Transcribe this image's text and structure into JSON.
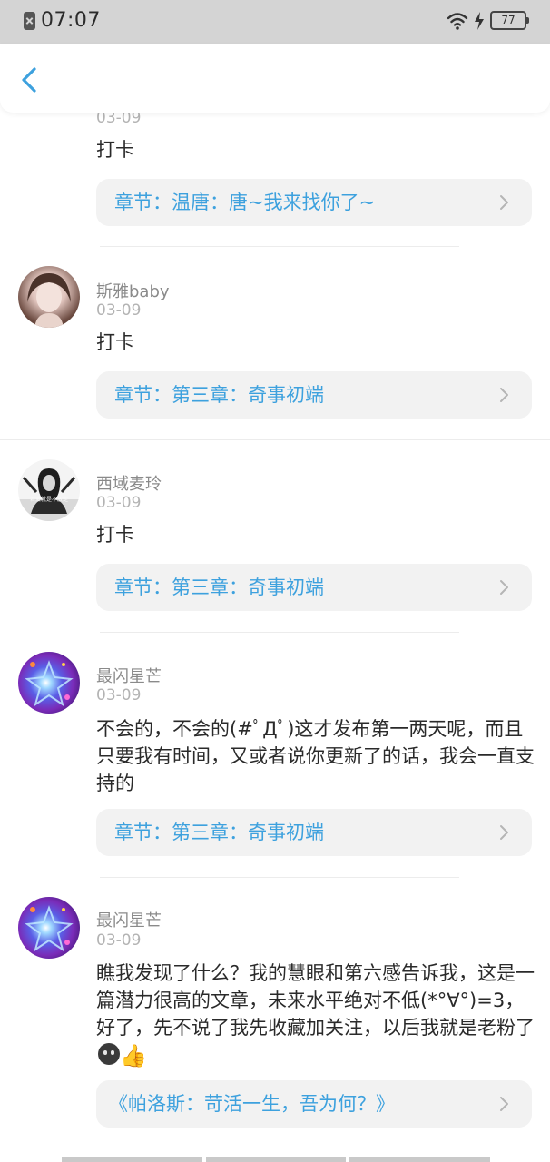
{
  "status_bar": {
    "time": "07:07",
    "battery": "77"
  },
  "comments": [
    {
      "date": "03-09",
      "text": "打卡",
      "chapter": "章节：温唐：唐~我来找你了~"
    },
    {
      "username": "斯雅baby",
      "date": "03-09",
      "text": "打卡",
      "chapter": "章节：第三章：奇事初端"
    },
    {
      "username": "西域麦玲",
      "date": "03-09",
      "text": "打卡",
      "chapter": "章节：第三章：奇事初端",
      "avatar_caption": "若爱就是不放走"
    },
    {
      "username": "最闪星芒",
      "date": "03-09",
      "text": "不会的，不会的(#ﾟДﾟ)这才发布第一两天呢，而且只要我有时间，又或者说你更新了的话，我会一直支持的",
      "chapter": "章节：第三章：奇事初端"
    },
    {
      "username": "最闪星芒",
      "date": "03-09",
      "text": "瞧我发现了什么？我的慧眼和第六感告诉我，这是一篇潜力很高的文章，未来水平绝对不低(*°∀°)=3，好了，先不说了我先收藏加关注，以后我就是老粉了",
      "chapter": "《帕洛斯：苛活一生，吾为何？》"
    }
  ],
  "icons": {
    "back": "chevron-left-icon",
    "chapter_arrow": "chevron-right-icon",
    "emoji_1": "smiling-face-icon",
    "emoji_2": "thumbs-up-icon"
  },
  "colors": {
    "accent": "#3da1de",
    "status_bar_bg": "#d4d4d4",
    "chip_bg": "#f2f2f2"
  }
}
